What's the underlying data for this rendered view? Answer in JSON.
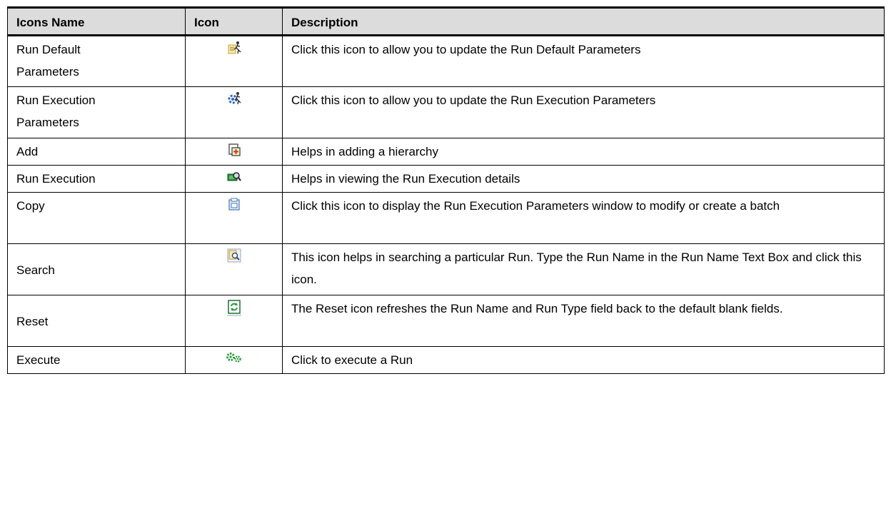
{
  "table": {
    "headers": [
      "Icons Name",
      "Icon",
      "Description"
    ],
    "rows": [
      {
        "name": "Run Default Parameters",
        "icon": "run-default-parameters-icon",
        "description": "Click this icon to allow you to update the Run Default Parameters"
      },
      {
        "name": "Run Execution Parameters",
        "icon": "run-execution-parameters-icon",
        "description": "Click this icon to allow you to update the Run Execution Parameters"
      },
      {
        "name": "Add",
        "icon": "add-icon",
        "description": "Helps in adding a hierarchy"
      },
      {
        "name": "Run Execution",
        "icon": "run-execution-icon",
        "description": "Helps in viewing the Run Execution details"
      },
      {
        "name": "Copy",
        "icon": "copy-icon",
        "description": "Click this icon to display the Run Execution Parameters window to modify or create a batch"
      },
      {
        "name": "Search",
        "icon": "search-icon",
        "description": "This icon helps in searching a particular Run. Type the Run Name in the Run Name Text Box and click this icon."
      },
      {
        "name": "Reset",
        "icon": "reset-icon",
        "description": "The Reset icon refreshes the Run Name and Run Type field back to the default blank fields."
      },
      {
        "name": "Execute",
        "icon": "execute-icon",
        "description": "Click to execute a Run"
      }
    ]
  },
  "colors": {
    "header_bg": "#dcdcdc",
    "border": "#000000"
  }
}
